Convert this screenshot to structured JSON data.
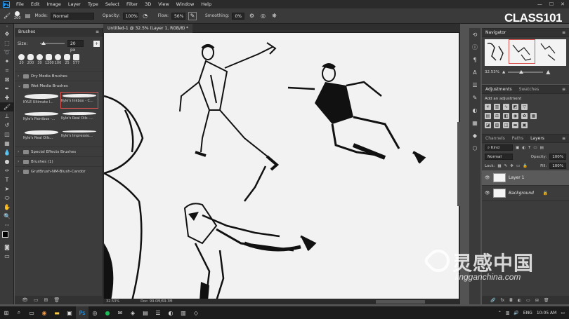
{
  "app": {
    "logo": "Ps"
  },
  "menu": [
    "File",
    "Edit",
    "Image",
    "Layer",
    "Type",
    "Select",
    "Filter",
    "3D",
    "View",
    "Window",
    "Help"
  ],
  "options": {
    "brush_size": "200",
    "mode_label": "Mode:",
    "mode_value": "Normal",
    "opacity_label": "Opacity:",
    "opacity_value": "100%",
    "flow_label": "Flow:",
    "flow_value": "56%",
    "smoothing_label": "Smoothing:",
    "smoothing_value": "0%"
  },
  "brand": "CLASS101",
  "brushes_panel": {
    "title": "Brushes",
    "size_label": "Size:",
    "size_value": "20 px",
    "presets": [
      "20",
      "200",
      "30",
      "1200",
      "100",
      "25",
      "577"
    ],
    "groups": {
      "dry": "Dry Media Brushes",
      "wet": "Wet Media Brushes",
      "special": "Special Effects Brushes",
      "brushes1": "Brushes (1)",
      "grut": "GrutBrush-NM-Blush-Candor"
    },
    "wet_items": [
      "KYLE Ultimate I...",
      "Kyle's Inkbox - C...",
      "Kyle's Paintbox -...",
      "Kyle's Real Oils -...",
      "Kyle's Real Oils...",
      "Kyle's Impressio..."
    ]
  },
  "document": {
    "tab": "Untitled-1 @ 32.5% (Layer 1, RGB/8) *",
    "zoom": "32.53%",
    "doc_size": "Doc: 99.0M/69.3M"
  },
  "navigator": {
    "title": "Navigator",
    "zoom": "32.53%"
  },
  "adjustments": {
    "tab1": "Adjustments",
    "tab2": "Swatches",
    "hint": "Add an adjustment"
  },
  "layers_panel": {
    "tabs": [
      "Channels",
      "Paths",
      "Layers"
    ],
    "kind": "Kind",
    "blend": "Normal",
    "opacity_label": "Opacity:",
    "opacity": "100%",
    "lock_label": "Lock:",
    "fill_label": "Fill:",
    "fill": "100%",
    "layers": [
      "Layer 1",
      "Background"
    ]
  },
  "watermark": {
    "cn": "灵感中国",
    "url": "lingganchina.com"
  },
  "taskbar": {
    "lang": "ENG",
    "time": "10:05 AM"
  }
}
